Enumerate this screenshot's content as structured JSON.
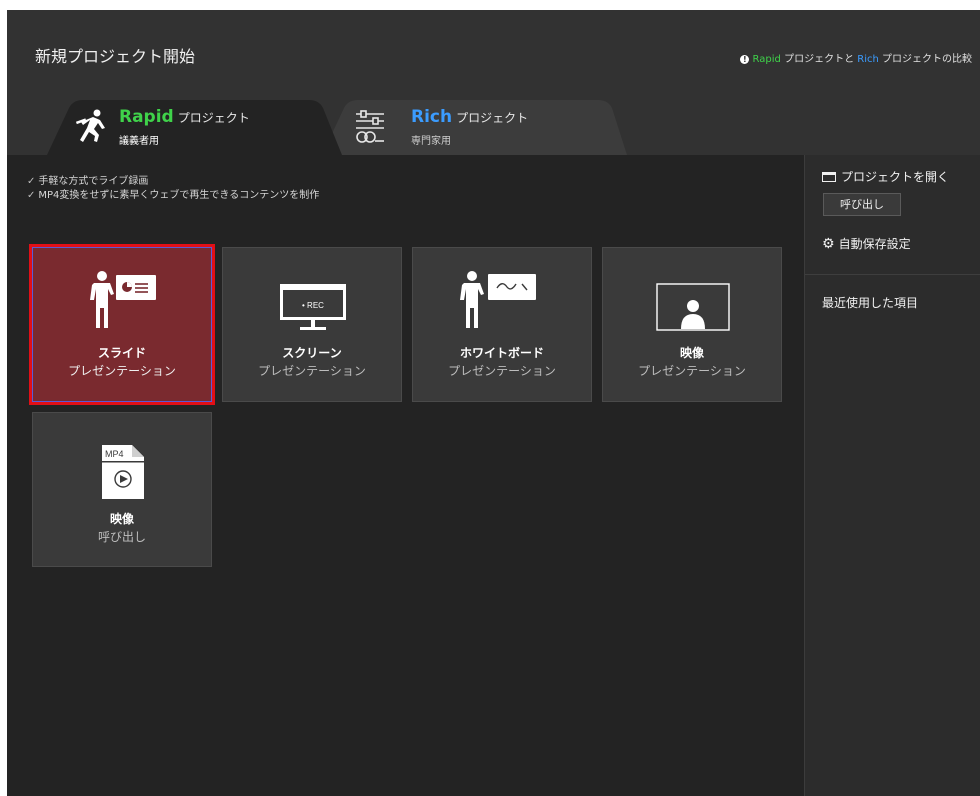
{
  "header": {
    "title": "新規プロジェクト開始",
    "compare_prefix": "Rapid",
    "compare_mid": " プロジェクトと ",
    "compare_rich": "Rich",
    "compare_suffix": " プロジェクトの比較"
  },
  "tabs": [
    {
      "name": "Rapid",
      "suffix": "プロジェクト",
      "desc": "議義者用",
      "active": true
    },
    {
      "name": "Rich",
      "suffix": "プロジェクト",
      "desc": "専門家用",
      "active": false
    }
  ],
  "features": [
    "手軽な方式でライブ録画",
    "MP4変換をせずに素早くウェブで再生できるコンテンツを制作"
  ],
  "cards": [
    {
      "title": "スライド",
      "subtitle": "プレゼンテーション",
      "selected": true
    },
    {
      "title": "スクリーン",
      "subtitle": "プレゼンテーション",
      "selected": false,
      "screen_text": "• REC"
    },
    {
      "title": "ホワイトボード",
      "subtitle": "プレゼンテーション",
      "selected": false
    },
    {
      "title": "映像",
      "subtitle": "プレゼンテーション",
      "selected": false
    },
    {
      "title": "映像",
      "subtitle": "呼び出し",
      "selected": false,
      "file_text": "MP4"
    }
  ],
  "sidebar": {
    "open_project": "プロジェクトを開く",
    "call_button": "呼び出し",
    "autosave": "自動保存設定",
    "recent": "最近使用した項目"
  },
  "colors": {
    "rapid_green": "#3fd24a",
    "rich_blue": "#3b9cff",
    "selected_card": "#7a2a2f",
    "highlight_red": "#e10f17"
  }
}
